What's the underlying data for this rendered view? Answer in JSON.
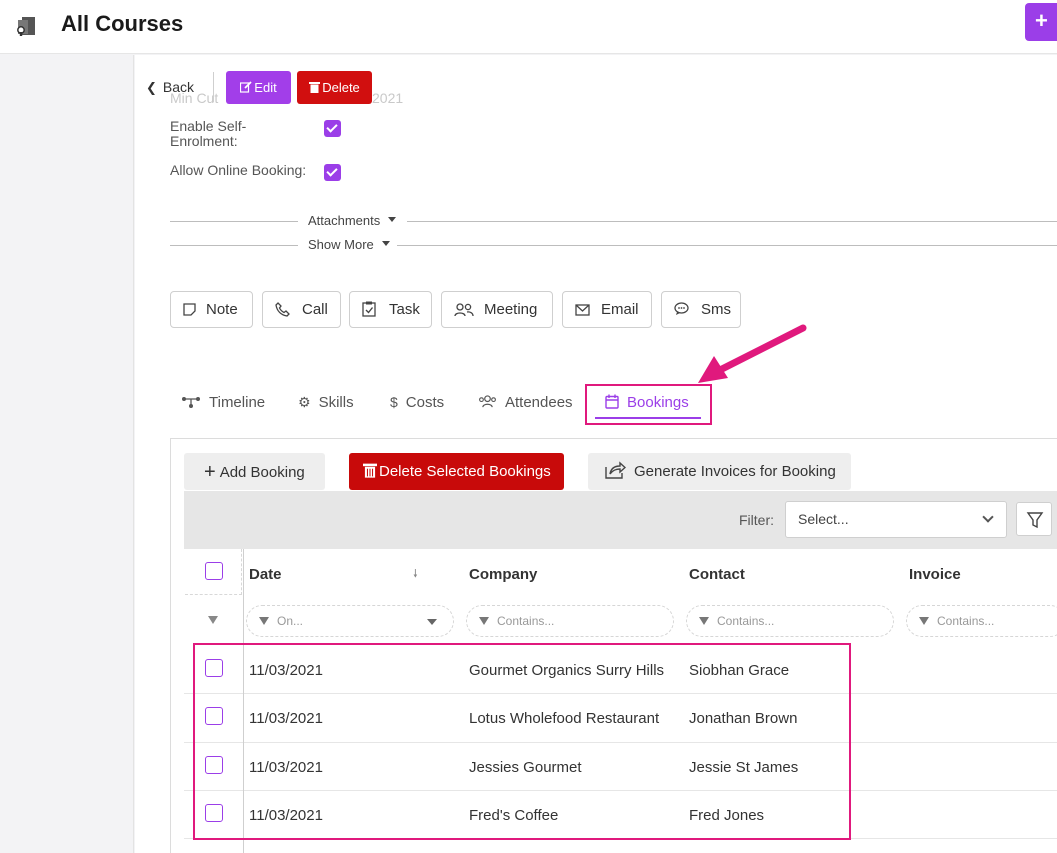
{
  "header": {
    "title": "All Courses",
    "plus_label": "+"
  },
  "toolbar": {
    "back_label": "Back",
    "edit_label": "Edit",
    "delete_label": "Delete",
    "ghost_left": "Min Cut",
    "ghost_right": "2021"
  },
  "fields": {
    "self_enrolment_label_1": "Enable Self-",
    "self_enrolment_label_2": "Enrolment:",
    "online_booking_label": "Allow Online Booking:",
    "self_enrolment_checked": true,
    "online_booking_checked": true
  },
  "sections": {
    "attachments_label": "Attachments",
    "show_more_label": "Show More"
  },
  "actions": [
    {
      "label": "Note",
      "icon": "note-icon"
    },
    {
      "label": "Call",
      "icon": "phone-icon"
    },
    {
      "label": "Task",
      "icon": "clipboard-check-icon"
    },
    {
      "label": "Meeting",
      "icon": "users-icon"
    },
    {
      "label": "Email",
      "icon": "envelope-icon"
    },
    {
      "label": "Sms",
      "icon": "chat-icon"
    }
  ],
  "tabs": [
    {
      "label": "Timeline",
      "icon": "timeline-icon"
    },
    {
      "label": "Skills",
      "icon": "gears-icon"
    },
    {
      "label": "Costs",
      "icon": "dollar-icon"
    },
    {
      "label": "Attendees",
      "icon": "users-icon"
    },
    {
      "label": "Bookings",
      "icon": "calendar-icon",
      "active": true
    }
  ],
  "bookings": {
    "add_label": "Add Booking",
    "delete_selected_label": "Delete Selected Bookings",
    "generate_invoices_label": "Generate Invoices for Booking",
    "filter_label": "Filter:",
    "filter_placeholder": "Select...",
    "columns": [
      "Date",
      "Company",
      "Contact",
      "Invoice"
    ],
    "column_filters": [
      "On...",
      "Contains...",
      "Contains...",
      "Contains..."
    ],
    "rows": [
      {
        "date": "11/03/2021",
        "company": "Gourmet Organics Surry Hills",
        "contact": "Siobhan Grace",
        "invoice": ""
      },
      {
        "date": "11/03/2021",
        "company": "Lotus Wholefood Restaurant",
        "contact": "Jonathan Brown",
        "invoice": ""
      },
      {
        "date": "11/03/2021",
        "company": "Jessies Gourmet",
        "contact": "Jessie St James",
        "invoice": ""
      },
      {
        "date": "11/03/2021",
        "company": "Fred's Coffee",
        "contact": "Fred Jones",
        "invoice": ""
      }
    ]
  },
  "colors": {
    "accent": "#9b3ee8",
    "danger": "#c80a0a",
    "annotation": "#e0197d"
  }
}
